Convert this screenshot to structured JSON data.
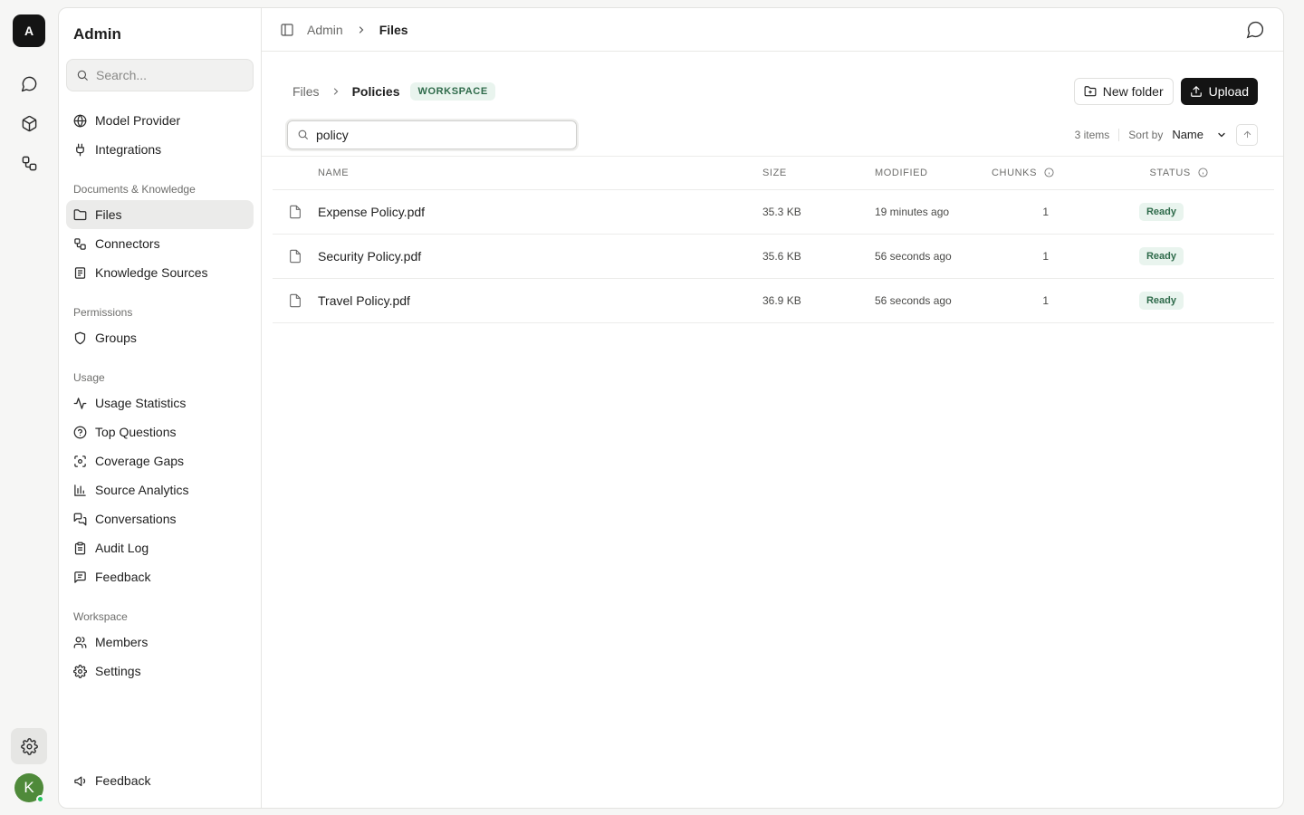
{
  "rail": {
    "logo_letter": "A",
    "items": [
      "chat-icon",
      "cube-icon",
      "workflow-icon"
    ],
    "settings_icon": "gear-icon",
    "avatar_letter": "K"
  },
  "sidebar": {
    "title": "Admin",
    "search_placeholder": "Search...",
    "top_items": [
      {
        "label": "Model Provider",
        "icon": "globe-icon"
      },
      {
        "label": "Integrations",
        "icon": "plug-icon"
      }
    ],
    "groups": [
      {
        "title": "Documents & Knowledge",
        "items": [
          {
            "label": "Files",
            "icon": "folder-icon",
            "active": true
          },
          {
            "label": "Connectors",
            "icon": "connectors-icon"
          },
          {
            "label": "Knowledge Sources",
            "icon": "book-icon"
          }
        ]
      },
      {
        "title": "Permissions",
        "items": [
          {
            "label": "Groups",
            "icon": "shield-icon"
          }
        ]
      },
      {
        "title": "Usage",
        "items": [
          {
            "label": "Usage Statistics",
            "icon": "activity-icon"
          },
          {
            "label": "Top Questions",
            "icon": "help-circle-icon"
          },
          {
            "label": "Coverage Gaps",
            "icon": "scan-icon"
          },
          {
            "label": "Source Analytics",
            "icon": "bar-chart-icon"
          },
          {
            "label": "Conversations",
            "icon": "messages-icon"
          },
          {
            "label": "Audit Log",
            "icon": "clipboard-icon"
          },
          {
            "label": "Feedback",
            "icon": "message-square-icon"
          }
        ]
      },
      {
        "title": "Workspace",
        "items": [
          {
            "label": "Members",
            "icon": "users-icon"
          },
          {
            "label": "Settings",
            "icon": "gear-icon"
          }
        ]
      }
    ],
    "footer_item": {
      "label": "Feedback",
      "icon": "megaphone-icon"
    }
  },
  "topbar": {
    "crumb_root": "Admin",
    "crumb_current": "Files"
  },
  "header": {
    "crumb_root": "Files",
    "crumb_current": "Policies",
    "badge": "WORKSPACE",
    "new_folder_label": "New folder",
    "upload_label": "Upload"
  },
  "filter": {
    "search_value": "policy",
    "items_count": "3 items",
    "sort_label": "Sort by",
    "sort_value": "Name"
  },
  "table": {
    "columns": [
      "NAME",
      "SIZE",
      "MODIFIED",
      "CHUNKS",
      "STATUS"
    ],
    "rows": [
      {
        "name": "Expense Policy.pdf",
        "size": "35.3 KB",
        "modified": "19 minutes ago",
        "chunks": "1",
        "status": "Ready"
      },
      {
        "name": "Security Policy.pdf",
        "size": "35.6 KB",
        "modified": "56 seconds ago",
        "chunks": "1",
        "status": "Ready"
      },
      {
        "name": "Travel Policy.pdf",
        "size": "36.9 KB",
        "modified": "56 seconds ago",
        "chunks": "1",
        "status": "Ready"
      }
    ]
  }
}
